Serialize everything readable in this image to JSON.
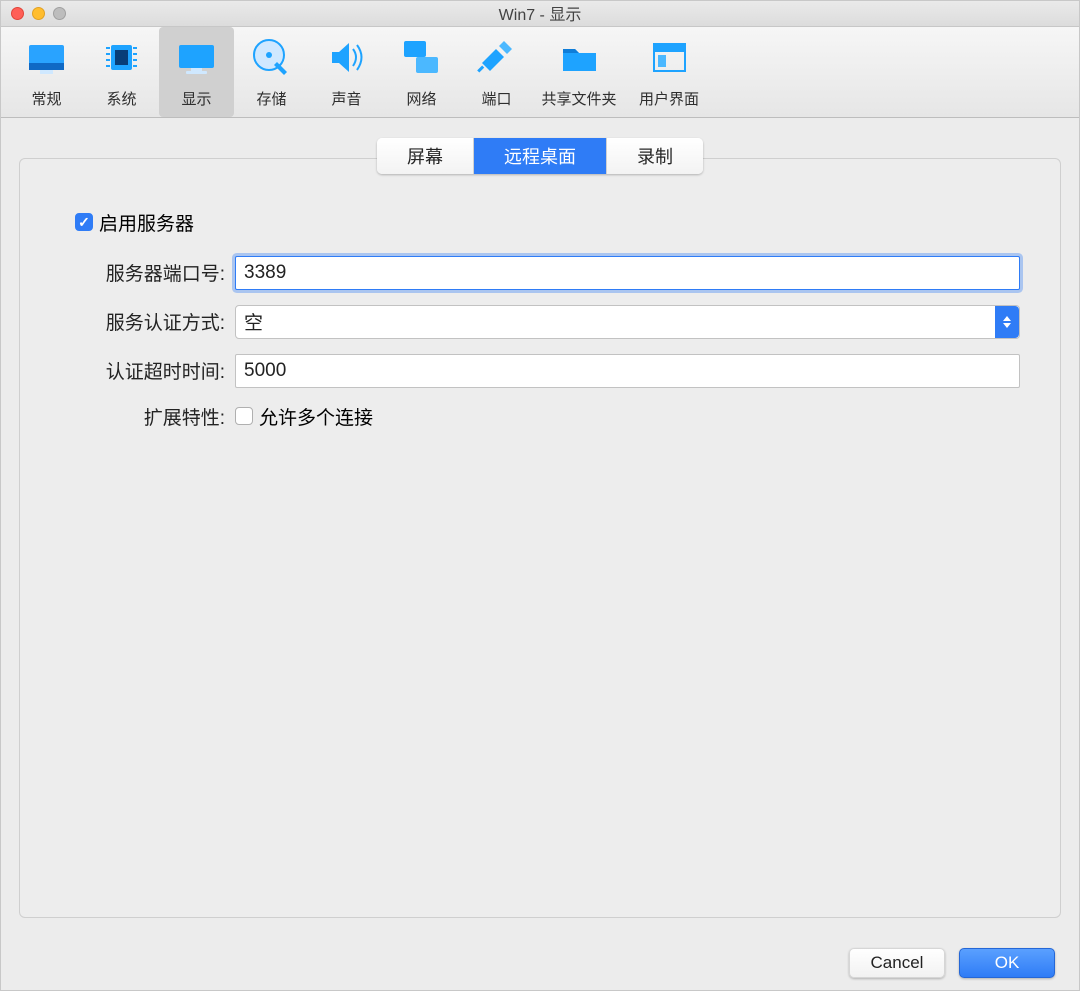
{
  "window": {
    "title": "Win7 - 显示"
  },
  "toolbar": {
    "items": [
      {
        "id": "general",
        "label": "常规"
      },
      {
        "id": "system",
        "label": "系统"
      },
      {
        "id": "display",
        "label": "显示"
      },
      {
        "id": "storage",
        "label": "存储"
      },
      {
        "id": "audio",
        "label": "声音"
      },
      {
        "id": "network",
        "label": "网络"
      },
      {
        "id": "ports",
        "label": "端口"
      },
      {
        "id": "shared",
        "label": "共享文件夹"
      },
      {
        "id": "ui",
        "label": "用户界面"
      }
    ],
    "selected": "display"
  },
  "tabs": {
    "items": [
      {
        "id": "screen",
        "label": "屏幕"
      },
      {
        "id": "remote",
        "label": "远程桌面"
      },
      {
        "id": "recording",
        "label": "录制"
      }
    ],
    "active": "remote"
  },
  "form": {
    "enable_server": {
      "label": "启用服务器",
      "checked": true
    },
    "port": {
      "label": "服务器端口号:",
      "value": "3389"
    },
    "auth_method": {
      "label": "服务认证方式:",
      "selected": "空"
    },
    "auth_timeout": {
      "label": "认证超时时间:",
      "value": "5000"
    },
    "extended": {
      "label": "扩展特性:",
      "checkbox_label": "允许多个连接",
      "checked": false
    }
  },
  "footer": {
    "cancel": "Cancel",
    "ok": "OK"
  },
  "colors": {
    "accent": "#2f7cf6",
    "panel_bg": "#ededed"
  }
}
